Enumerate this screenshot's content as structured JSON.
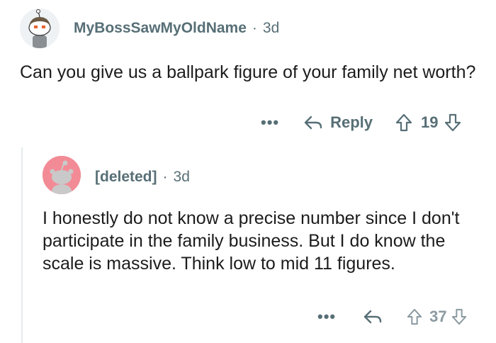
{
  "comments": [
    {
      "username": "MyBossSawMyOldName",
      "separator": "·",
      "age": "3d",
      "text": "Can you give us a ballpark figure of your family net worth?",
      "actions": {
        "more": "•••",
        "reply_label": "Reply",
        "score": "19"
      }
    },
    {
      "username": "[deleted]",
      "separator": "·",
      "age": "3d",
      "text": "I honestly do not know a precise number since I don't participate in the family business. But I do know the scale is massive. Think low to mid 11 figures.",
      "actions": {
        "more": "•••",
        "score": "37"
      }
    }
  ],
  "colors": {
    "meta_gray": "#576f76",
    "deleted_avatar": "#f28b95",
    "thread_line": "#e5ebee"
  }
}
